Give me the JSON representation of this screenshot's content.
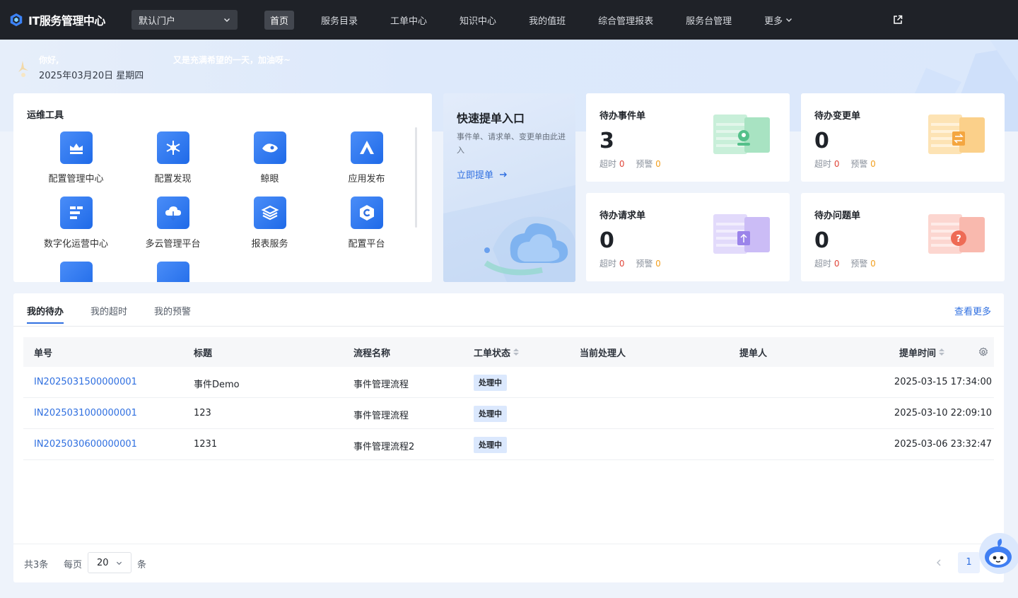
{
  "app": {
    "title": "IT服务管理中心"
  },
  "portal": {
    "selected": "默认门户"
  },
  "nav": {
    "items": [
      {
        "label": "首页",
        "active": true
      },
      {
        "label": "服务目录"
      },
      {
        "label": "工单中心"
      },
      {
        "label": "知识中心"
      },
      {
        "label": "我的值班"
      },
      {
        "label": "综合管理报表"
      },
      {
        "label": "服务台管理"
      }
    ],
    "more_label": "更多"
  },
  "banner": {
    "hello": "你好,",
    "motto": "又是充满希望的一天，加油呀~",
    "date": "2025年03月20日 星期四"
  },
  "tools": {
    "title": "运维工具",
    "items": [
      {
        "label": "配置管理中心",
        "icon": "cmdb-icon"
      },
      {
        "label": "配置发现",
        "icon": "snowflake-icon"
      },
      {
        "label": "鲸眼",
        "icon": "whale-eye-icon"
      },
      {
        "label": "应用发布",
        "icon": "deploy-icon"
      },
      {
        "label": "数字化运营中心",
        "icon": "digital-ops-icon"
      },
      {
        "label": "多云管理平台",
        "icon": "cloud-icon"
      },
      {
        "label": "报表服务",
        "icon": "layers-icon"
      },
      {
        "label": "配置平台",
        "icon": "config-icon"
      }
    ]
  },
  "quick": {
    "title": "快速提单入口",
    "desc": "事件单、请求单、变更单由此进入",
    "link": "立即提单"
  },
  "stats": {
    "overdue_label": "超时",
    "warning_label": "预警",
    "cards": [
      {
        "title": "待办事件单",
        "count": "3",
        "overdue": "0",
        "warning": "0"
      },
      {
        "title": "待办变更单",
        "count": "0",
        "overdue": "0",
        "warning": "0"
      },
      {
        "title": "待办请求单",
        "count": "0",
        "overdue": "0",
        "warning": "0"
      },
      {
        "title": "待办问题单",
        "count": "0",
        "overdue": "0",
        "warning": "0"
      }
    ]
  },
  "todo": {
    "tabs": [
      "我的待办",
      "我的超时",
      "我的预警"
    ],
    "more": "查看更多",
    "columns": [
      "单号",
      "标题",
      "流程名称",
      "工单状态",
      "当前处理人",
      "提单人",
      "提单时间"
    ],
    "rows": [
      {
        "id": "IN2025031500000001",
        "title": "事件Demo",
        "flow": "事件管理流程",
        "status": "处理中",
        "handler": "",
        "submitter": "",
        "time": "2025-03-15 17:34:00"
      },
      {
        "id": "IN2025031000000001",
        "title": "123",
        "flow": "事件管理流程",
        "status": "处理中",
        "handler": "",
        "submitter": "",
        "time": "2025-03-10 22:09:10"
      },
      {
        "id": "IN2025030600000001",
        "title": "1231",
        "flow": "事件管理流程2",
        "status": "处理中",
        "handler": "",
        "submitter": "",
        "time": "2025-03-06 23:32:47"
      }
    ],
    "pager": {
      "total": "共3条",
      "per_page_label": "每页",
      "per_page": "20",
      "unit": "条",
      "current_page": "1"
    }
  },
  "colors": {
    "accent": "#2f6fe0",
    "nav_bg": "#1f2228",
    "badge_bg": "#dbe8fd",
    "overdue": "#e0463a",
    "warning": "#f2a020"
  }
}
